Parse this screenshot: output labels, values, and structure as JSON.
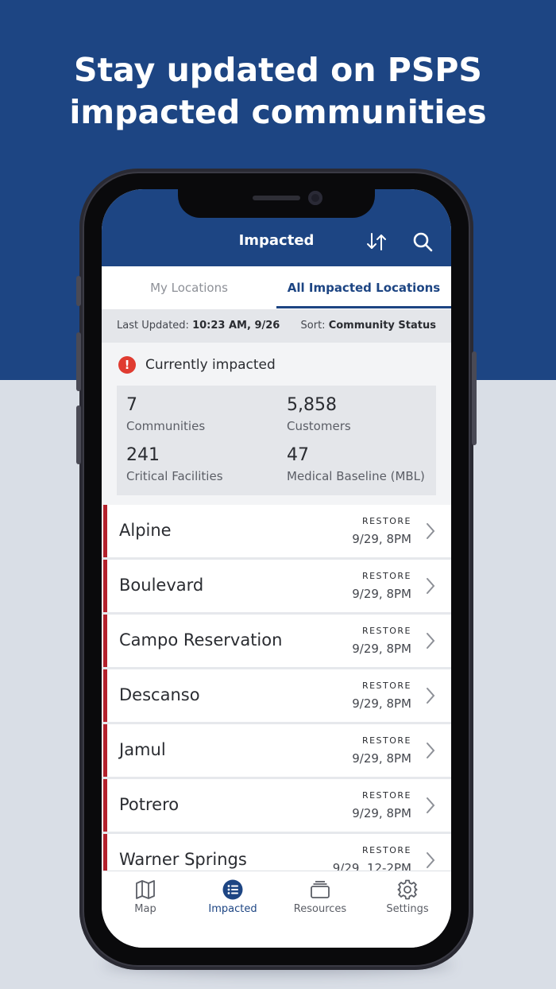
{
  "headline": {
    "line1": "Stay updated on PSPS",
    "line2": "impacted communities"
  },
  "appbar": {
    "title": "Impacted",
    "sort_icon": "sort-arrows-icon",
    "search_icon": "search-icon"
  },
  "tabs": [
    {
      "label": "My Locations",
      "active": false
    },
    {
      "label": "All Impacted Locations",
      "active": true
    }
  ],
  "meta": {
    "last_updated_label": "Last Updated:",
    "last_updated_value": "10:23 AM, 9/26",
    "sort_label": "Sort:",
    "sort_value": "Community Status"
  },
  "summary": {
    "status": "Currently impacted",
    "stats": [
      {
        "value": "7",
        "label": "Communities"
      },
      {
        "value": "5,858",
        "label": "Customers"
      },
      {
        "value": "241",
        "label": "Critical Facilities"
      },
      {
        "value": "47",
        "label": "Medical Baseline (MBL)"
      }
    ]
  },
  "communities": [
    {
      "name": "Alpine",
      "restore_label": "RESTORE",
      "restore_time": "9/29, 8PM"
    },
    {
      "name": "Boulevard",
      "restore_label": "RESTORE",
      "restore_time": "9/29, 8PM"
    },
    {
      "name": "Campo Reservation",
      "restore_label": "RESTORE",
      "restore_time": "9/29, 8PM"
    },
    {
      "name": "Descanso",
      "restore_label": "RESTORE",
      "restore_time": "9/29, 8PM"
    },
    {
      "name": "Jamul",
      "restore_label": "RESTORE",
      "restore_time": "9/29, 8PM"
    },
    {
      "name": "Potrero",
      "restore_label": "RESTORE",
      "restore_time": "9/29, 8PM"
    },
    {
      "name": "Warner Springs",
      "restore_label": "RESTORE",
      "restore_time": "9/29, 12-2PM"
    }
  ],
  "bottom_nav": [
    {
      "label": "Map",
      "icon": "map-icon",
      "active": false
    },
    {
      "label": "Impacted",
      "icon": "list-icon",
      "active": true
    },
    {
      "label": "Resources",
      "icon": "cards-icon",
      "active": false
    },
    {
      "label": "Settings",
      "icon": "gear-icon",
      "active": false
    }
  ],
  "colors": {
    "brand_blue": "#1d4583",
    "impact_red": "#b3202b",
    "alert_red": "#e03c31"
  }
}
